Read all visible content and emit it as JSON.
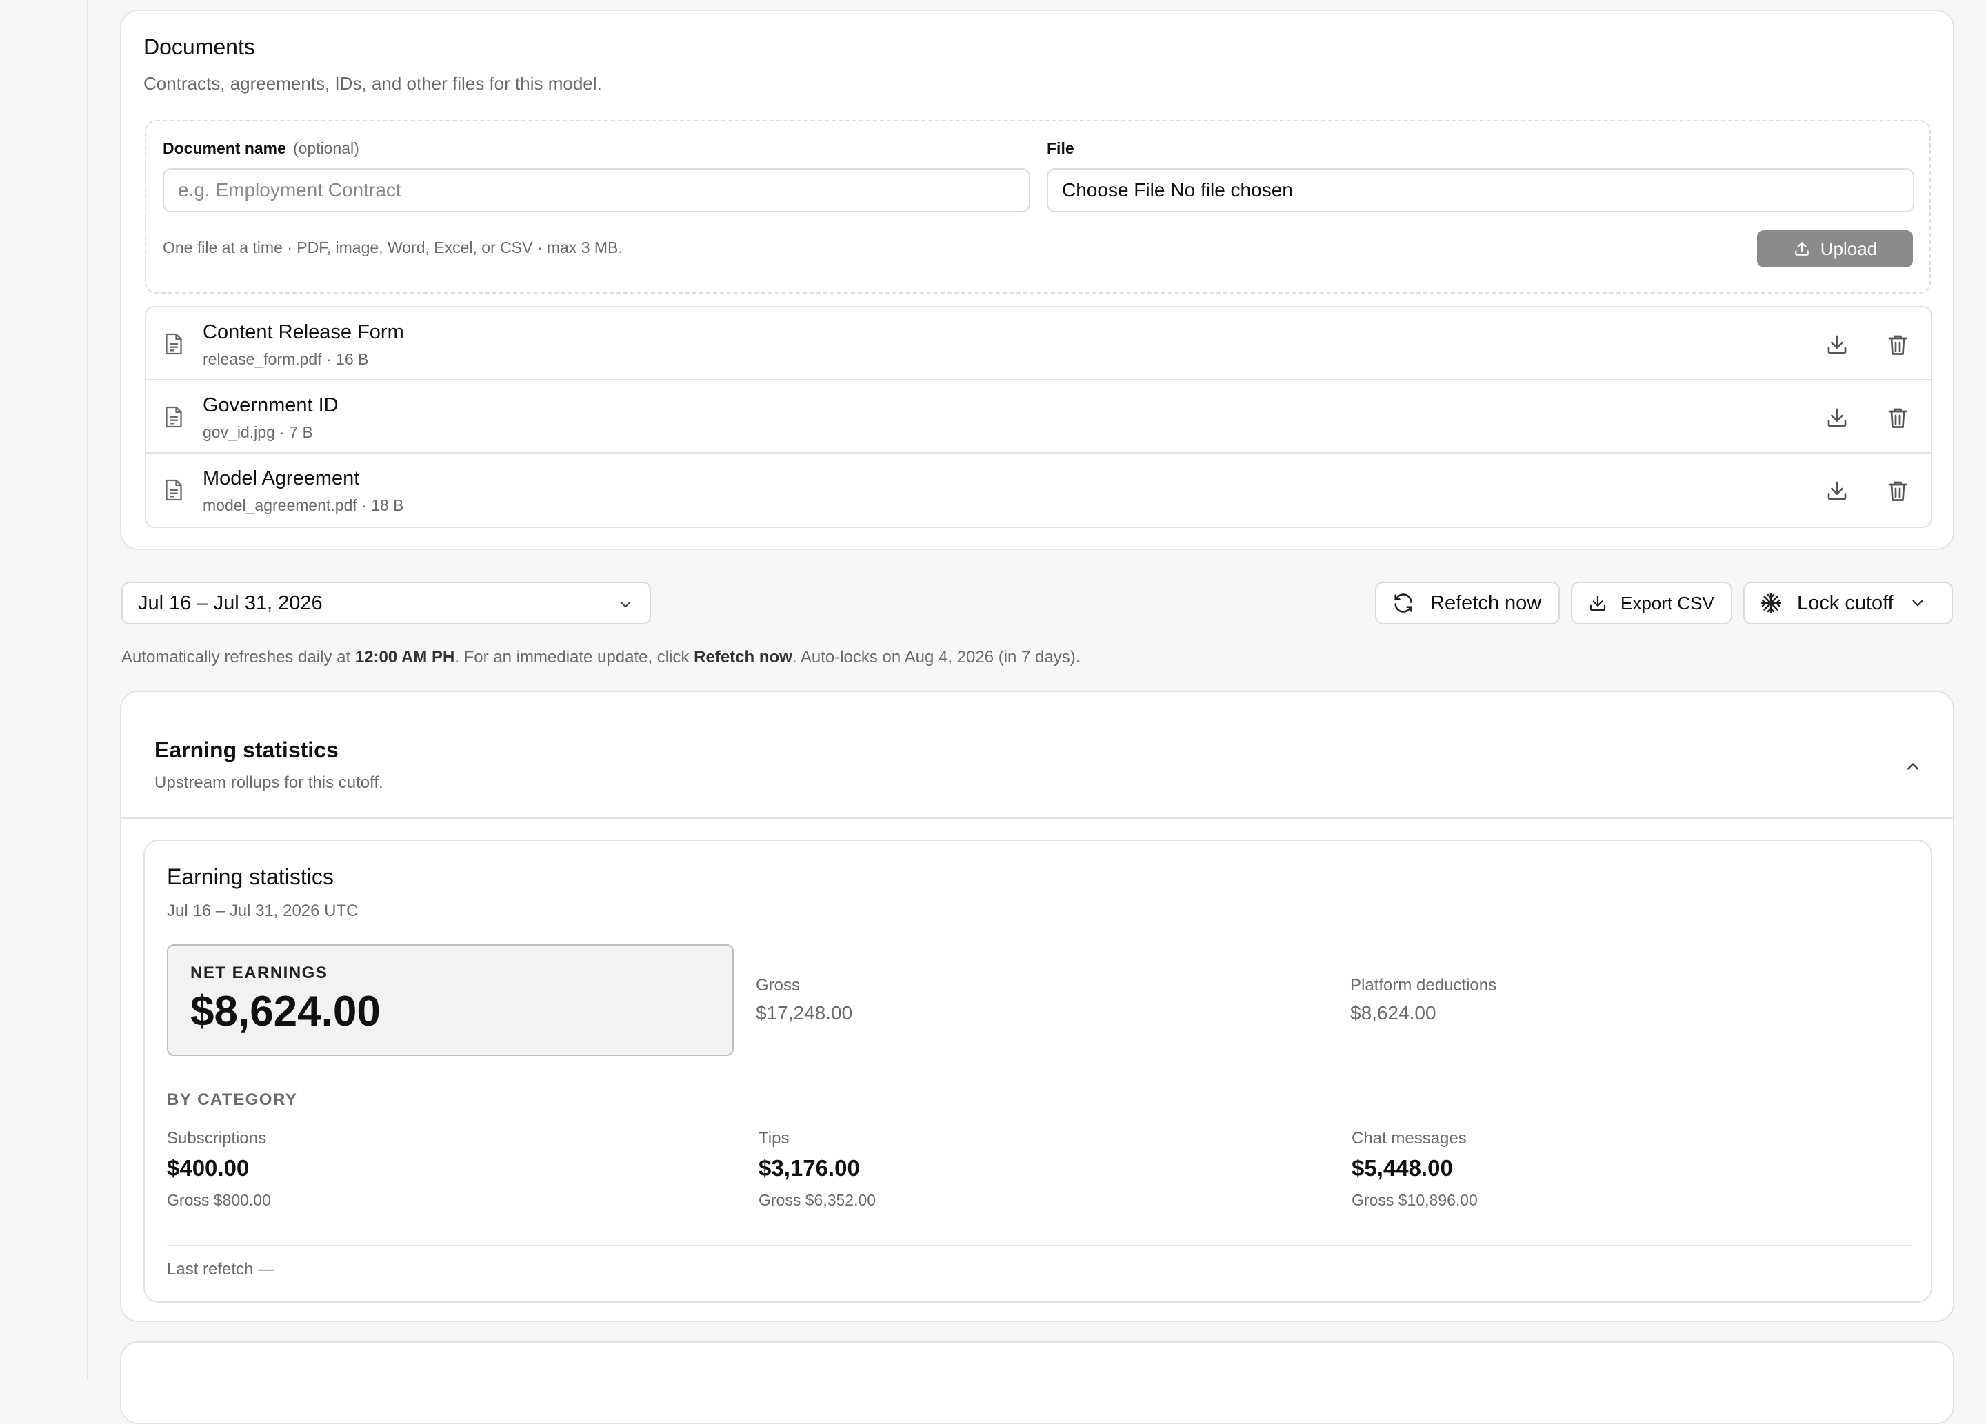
{
  "documents": {
    "title": "Documents",
    "subtitle": "Contracts, agreements, IDs, and other files for this model.",
    "name_label": "Document name",
    "name_optional": "(optional)",
    "name_placeholder": "e.g. Employment Contract",
    "file_label": "File",
    "file_button": "Choose File",
    "file_status": "No file chosen",
    "hint": "One file at a time · PDF, image, Word, Excel, or CSV · max 3 MB.",
    "upload_label": "Upload",
    "items": [
      {
        "name": "Content Release Form",
        "meta": "release_form.pdf · 16 B"
      },
      {
        "name": "Government ID",
        "meta": "gov_id.jpg · 7 B"
      },
      {
        "name": "Model Agreement",
        "meta": "model_agreement.pdf · 18 B"
      }
    ]
  },
  "toolbar": {
    "date_range": "Jul 16 – Jul 31, 2026",
    "refetch_label": "Refetch now",
    "export_label": "Export CSV",
    "lock_label": "Lock cutoff"
  },
  "autonote": {
    "part1": "Automatically refreshes daily at ",
    "time": "12:00 AM PH",
    "part2": ". For an immediate update, click ",
    "action": "Refetch now",
    "part3": ". Auto-locks on Aug 4, 2026 (in 7 days)."
  },
  "earnings_section": {
    "title": "Earning statistics",
    "subtitle": "Upstream rollups for this cutoff."
  },
  "earnings": {
    "title": "Earning statistics",
    "range": "Jul 16 – Jul 31, 2026 UTC",
    "net_label": "NET EARNINGS",
    "net_value": "$8,624.00",
    "gross_label": "Gross",
    "gross_value": "$17,248.00",
    "deductions_label": "Platform deductions",
    "deductions_value": "$8,624.00",
    "by_category_label": "BY CATEGORY",
    "categories": [
      {
        "label": "Subscriptions",
        "value": "$400.00",
        "gross": "Gross $800.00"
      },
      {
        "label": "Tips",
        "value": "$3,176.00",
        "gross": "Gross $6,352.00"
      },
      {
        "label": "Chat messages",
        "value": "$5,448.00",
        "gross": "Gross $10,896.00"
      }
    ],
    "last_refetch": "Last refetch —"
  },
  "icons": {
    "document": "file-text-icon",
    "download": "download-icon",
    "delete": "trash-icon",
    "upload": "upload-icon",
    "refresh": "refresh-icon",
    "export": "download-icon",
    "lock": "snowflake-icon",
    "dropdown": "chevron-down-icon",
    "collapse": "chevron-up-icon"
  }
}
